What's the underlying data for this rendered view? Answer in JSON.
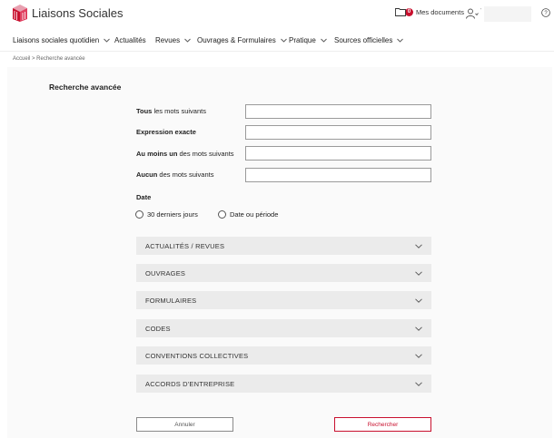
{
  "header": {
    "brand": "Liaisons Sociales",
    "docs_count": "0",
    "docs_label": "Mes documents",
    "user_marker": "'"
  },
  "nav": {
    "items": [
      {
        "label": "Liaisons sociales quotidien",
        "has_dropdown": true
      },
      {
        "label": "Actualités",
        "has_dropdown": false
      },
      {
        "label": "Revues",
        "has_dropdown": true
      },
      {
        "label": "Ouvrages & Formulaires",
        "has_dropdown": true
      },
      {
        "label": "Pratique",
        "has_dropdown": true
      },
      {
        "label": "Sources officielles",
        "has_dropdown": true
      }
    ]
  },
  "breadcrumb": "Accueil > Recherche avancée",
  "form": {
    "title": "Recherche avancée",
    "rows": [
      {
        "bold": "Tous",
        "rest": " les mots suivants",
        "value": ""
      },
      {
        "bold": "Expression exacte",
        "rest": "",
        "value": ""
      },
      {
        "bold": "Au moins un",
        "rest": " des mots suivants",
        "value": ""
      },
      {
        "bold": "Aucun",
        "rest": " des mots suivants",
        "value": ""
      }
    ],
    "date_label": "Date",
    "radios": [
      {
        "label": "30 derniers jours",
        "checked": false
      },
      {
        "label": "Date ou période",
        "checked": false
      }
    ],
    "sections": [
      "ACTUALITÉS / REVUES",
      "OUVRAGES",
      "FORMULAIRES",
      "CODES",
      "CONVENTIONS COLLECTIVES",
      "ACCORDS D'ENTREPRISE"
    ],
    "cancel_label": "Annuler",
    "search_label": "Rechercher"
  },
  "colors": {
    "accent": "#c8102e",
    "panel_bg": "#fafafa",
    "section_bg": "#ebebeb"
  },
  "icons": [
    "logo-icon",
    "folder-icon",
    "user-icon",
    "help-icon",
    "chevron-down-icon"
  ]
}
